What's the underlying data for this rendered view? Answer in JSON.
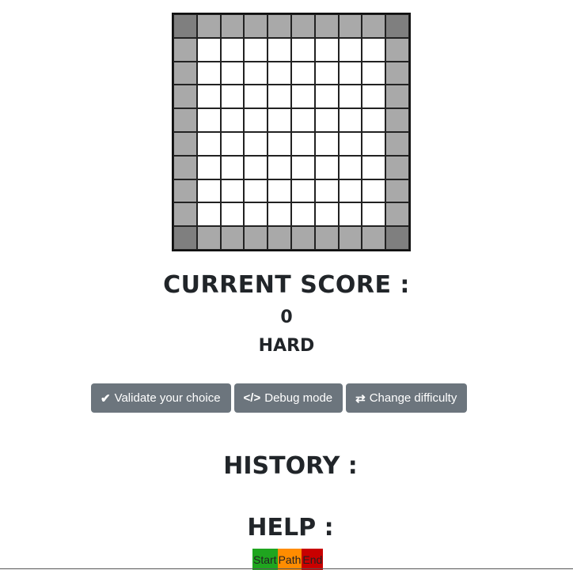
{
  "board": {
    "size": 10,
    "colors": {
      "corner": "#7f7f7f",
      "edge": "#a9a9a9",
      "inner": "#ffffff"
    }
  },
  "score": {
    "title": "CURRENT SCORE :",
    "value": "0",
    "difficulty": "HARD"
  },
  "buttons": {
    "validate": {
      "label": "Validate your choice",
      "icon": "check-icon",
      "glyph": "✔"
    },
    "debug": {
      "label": "Debug mode",
      "icon": "code-icon",
      "glyph": "</>"
    },
    "difficulty": {
      "label": "Change difficulty",
      "icon": "exchange-icon",
      "glyph": "⇄"
    }
  },
  "history": {
    "title": "HISTORY :"
  },
  "help": {
    "title": "HELP :",
    "legend": {
      "start": "Start",
      "path": "Path",
      "end": "End"
    }
  },
  "colors": {
    "button": "#6c757d",
    "start": "#1fa51f",
    "path": "#ff8c00",
    "end": "#c80000"
  }
}
